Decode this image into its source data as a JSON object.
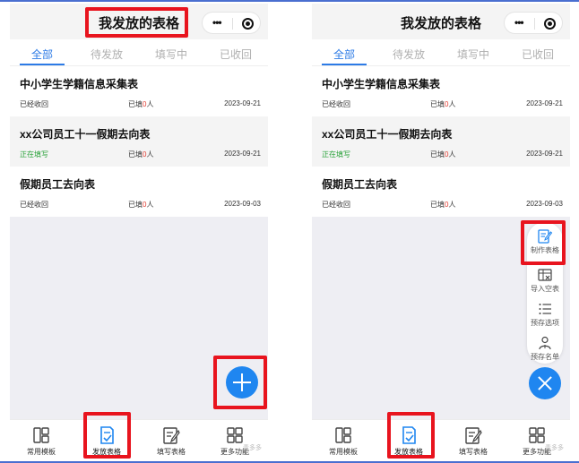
{
  "screens": [
    {
      "title": "我发放的表格",
      "tabs": [
        "全部",
        "待发放",
        "填写中",
        "已收回"
      ],
      "cards": [
        {
          "title": "中小学生学籍信息采集表",
          "status": "已经收回",
          "count_prefix": "已填",
          "count": "0",
          "count_suffix": "人",
          "date": "2023-09-21"
        },
        {
          "title": "xx公司员工十一假期去向表",
          "status": "正在填写",
          "count_prefix": "已填",
          "count": "0",
          "count_suffix": "人",
          "date": "2023-09-21"
        },
        {
          "title": "假期员工去向表",
          "status": "已经收回",
          "count_prefix": "已填",
          "count": "0",
          "count_suffix": "人",
          "date": "2023-09-03"
        }
      ],
      "bottom_nav": [
        "常用模板",
        "发放表格",
        "填写表格",
        "更多功能"
      ],
      "watermark": "青多多"
    },
    {
      "title": "我发放的表格",
      "tabs": [
        "全部",
        "待发放",
        "填写中",
        "已收回"
      ],
      "cards": [
        {
          "title": "中小学生学籍信息采集表",
          "status": "已经收回",
          "count_prefix": "已填",
          "count": "0",
          "count_suffix": "人",
          "date": "2023-09-21"
        },
        {
          "title": "xx公司员工十一假期去向表",
          "status": "正在填写",
          "count_prefix": "已填",
          "count": "0",
          "count_suffix": "人",
          "date": "2023-09-21"
        },
        {
          "title": "假期员工去向表",
          "status": "已经收回",
          "count_prefix": "已填",
          "count": "0",
          "count_suffix": "人",
          "date": "2023-09-03"
        }
      ],
      "bottom_nav": [
        "常用模板",
        "发放表格",
        "填写表格",
        "更多功能"
      ],
      "fab_menu": [
        "制作表格",
        "导入空表",
        "预存选项",
        "预存名单"
      ],
      "watermark": "青多多"
    }
  ],
  "colors": {
    "accent": "#2d7be6",
    "fab": "#1f86f0",
    "highlight": "#e8141e",
    "status_green": "#2aa23a",
    "count_red": "#e23a2e"
  },
  "icons": {
    "more": "more-dots-icon",
    "capsule_close": "target-icon",
    "add": "plus-icon",
    "close": "close-icon",
    "nav": [
      "template-grid-icon",
      "distribute-form-icon",
      "fill-form-icon",
      "more-grid-icon"
    ],
    "menu": [
      "create-form-icon",
      "import-form-icon",
      "preset-options-icon",
      "preset-list-icon"
    ]
  }
}
